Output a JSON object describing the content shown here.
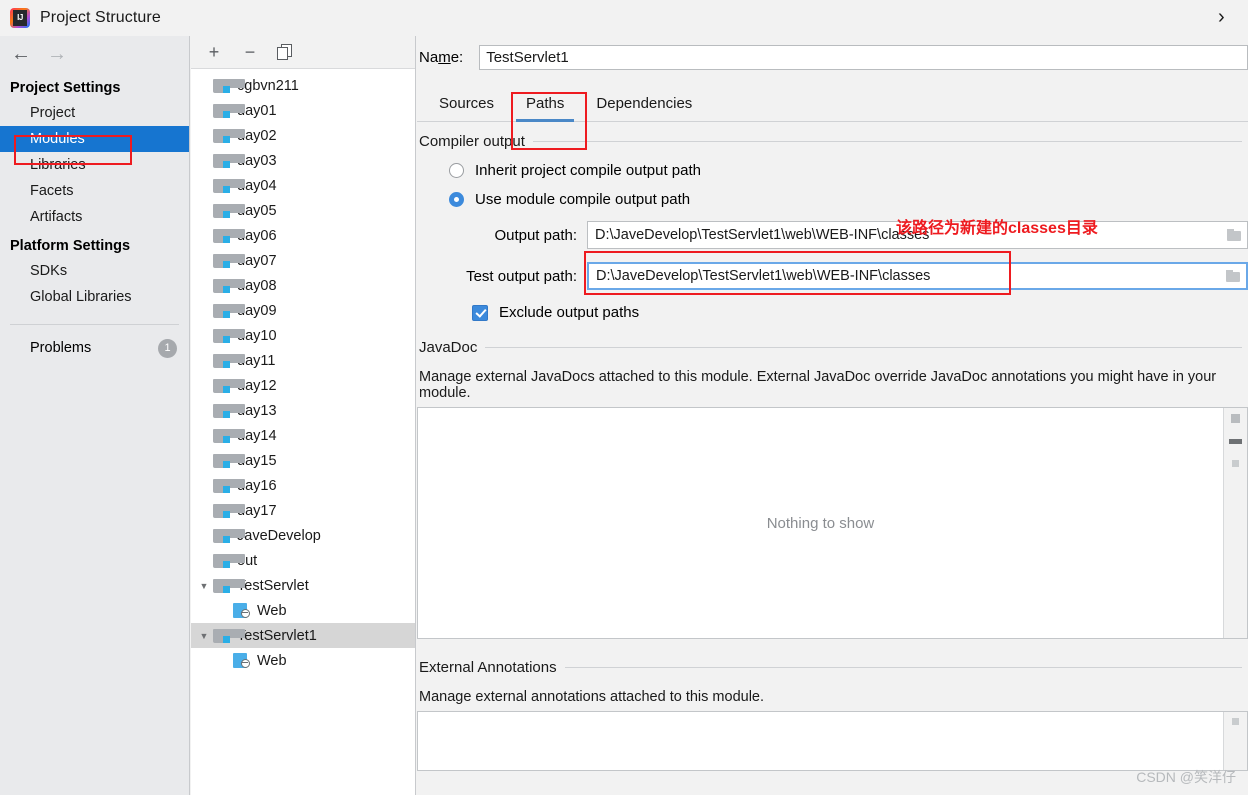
{
  "window": {
    "title": "Project Structure",
    "app_icon": "intellij-idea-logo",
    "close_glyph": "›"
  },
  "nav": {
    "back_glyph": "←",
    "forward_glyph": "→",
    "groups": [
      {
        "title": "Project Settings",
        "items": [
          {
            "label": "Project",
            "selected": false
          },
          {
            "label": "Modules",
            "selected": true
          },
          {
            "label": "Libraries",
            "selected": false
          },
          {
            "label": "Facets",
            "selected": false
          },
          {
            "label": "Artifacts",
            "selected": false
          }
        ]
      },
      {
        "title": "Platform Settings",
        "items": [
          {
            "label": "SDKs",
            "selected": false
          },
          {
            "label": "Global Libraries",
            "selected": false
          }
        ]
      }
    ],
    "problems": {
      "label": "Problems",
      "count": "1"
    },
    "selected_color": "#1675d0"
  },
  "tree": {
    "toolbar": {
      "add_glyph": "+",
      "remove_glyph": "−",
      "copy_label": "copy"
    },
    "items": [
      {
        "label": "cgbvn211",
        "icon": "module-folder-icon",
        "indent": 1,
        "twisty": "",
        "selected": false
      },
      {
        "label": "day01",
        "icon": "module-folder-icon",
        "indent": 1,
        "twisty": "",
        "selected": false
      },
      {
        "label": "day02",
        "icon": "module-folder-icon",
        "indent": 1,
        "twisty": "",
        "selected": false
      },
      {
        "label": "day03",
        "icon": "module-folder-icon",
        "indent": 1,
        "twisty": "",
        "selected": false
      },
      {
        "label": "day04",
        "icon": "module-folder-icon",
        "indent": 1,
        "twisty": "",
        "selected": false
      },
      {
        "label": "day05",
        "icon": "module-folder-icon",
        "indent": 1,
        "twisty": "",
        "selected": false
      },
      {
        "label": "day06",
        "icon": "module-folder-icon",
        "indent": 1,
        "twisty": "",
        "selected": false
      },
      {
        "label": "day07",
        "icon": "module-folder-icon",
        "indent": 1,
        "twisty": "",
        "selected": false
      },
      {
        "label": "day08",
        "icon": "module-folder-icon",
        "indent": 1,
        "twisty": "",
        "selected": false
      },
      {
        "label": "day09",
        "icon": "module-folder-icon",
        "indent": 1,
        "twisty": "",
        "selected": false
      },
      {
        "label": "day10",
        "icon": "module-folder-icon",
        "indent": 1,
        "twisty": "",
        "selected": false
      },
      {
        "label": "day11",
        "icon": "module-folder-icon",
        "indent": 1,
        "twisty": "",
        "selected": false
      },
      {
        "label": "day12",
        "icon": "module-folder-icon",
        "indent": 1,
        "twisty": "",
        "selected": false
      },
      {
        "label": "day13",
        "icon": "module-folder-icon",
        "indent": 1,
        "twisty": "",
        "selected": false
      },
      {
        "label": "day14",
        "icon": "module-folder-icon",
        "indent": 1,
        "twisty": "",
        "selected": false
      },
      {
        "label": "day15",
        "icon": "module-folder-icon",
        "indent": 1,
        "twisty": "",
        "selected": false
      },
      {
        "label": "day16",
        "icon": "module-folder-icon",
        "indent": 1,
        "twisty": "",
        "selected": false
      },
      {
        "label": "day17",
        "icon": "module-folder-icon",
        "indent": 1,
        "twisty": "",
        "selected": false
      },
      {
        "label": "JaveDevelop",
        "icon": "module-folder-icon",
        "indent": 1,
        "twisty": "",
        "selected": false
      },
      {
        "label": "out",
        "icon": "module-folder-icon",
        "indent": 1,
        "twisty": "",
        "selected": false
      },
      {
        "label": "TestServlet",
        "icon": "module-folder-icon",
        "indent": 0,
        "twisty": "▼",
        "selected": false
      },
      {
        "label": "Web",
        "icon": "web-facet-icon",
        "indent": 2,
        "twisty": "",
        "selected": false
      },
      {
        "label": "TestServlet1",
        "icon": "module-folder-icon",
        "indent": 0,
        "twisty": "▼",
        "selected": true
      },
      {
        "label": "Web",
        "icon": "web-facet-icon",
        "indent": 2,
        "twisty": "",
        "selected": false
      }
    ]
  },
  "module": {
    "name_label": "Name:",
    "name_value": "TestServlet1",
    "tabs": [
      {
        "label": "Sources",
        "active": false
      },
      {
        "label": "Paths",
        "active": true
      },
      {
        "label": "Dependencies",
        "active": false
      }
    ],
    "compiler_output": {
      "section_label": "Compiler output",
      "inherit_label": "Inherit project compile output path",
      "inherit_checked": false,
      "use_module_label": "Use module compile output path",
      "use_module_checked": true,
      "output_path_label": "Output path:",
      "output_path_value": "D:\\JaveDevelop\\TestServlet1\\web\\WEB-INF\\classes",
      "test_output_path_label": "Test output path:",
      "test_output_path_value": "D:\\JaveDevelop\\TestServlet1\\web\\WEB-INF\\classes",
      "exclude_label": "Exclude output paths",
      "exclude_checked": true
    },
    "javadoc": {
      "section_label": "JavaDoc",
      "description": "Manage external JavaDocs attached to this module. External JavaDoc override JavaDoc annotations you might have in your module.",
      "empty_text": "Nothing to show"
    },
    "external_annotations": {
      "section_label": "External Annotations",
      "description": "Manage external annotations attached to this module.",
      "empty_text": ""
    }
  },
  "annotations": {
    "note_text": "该路径为新建的classes目录",
    "note_color": "#ee1b20",
    "highlight_color": "#ee1b20"
  },
  "watermark": {
    "text": "CSDN @笑洋仔"
  }
}
